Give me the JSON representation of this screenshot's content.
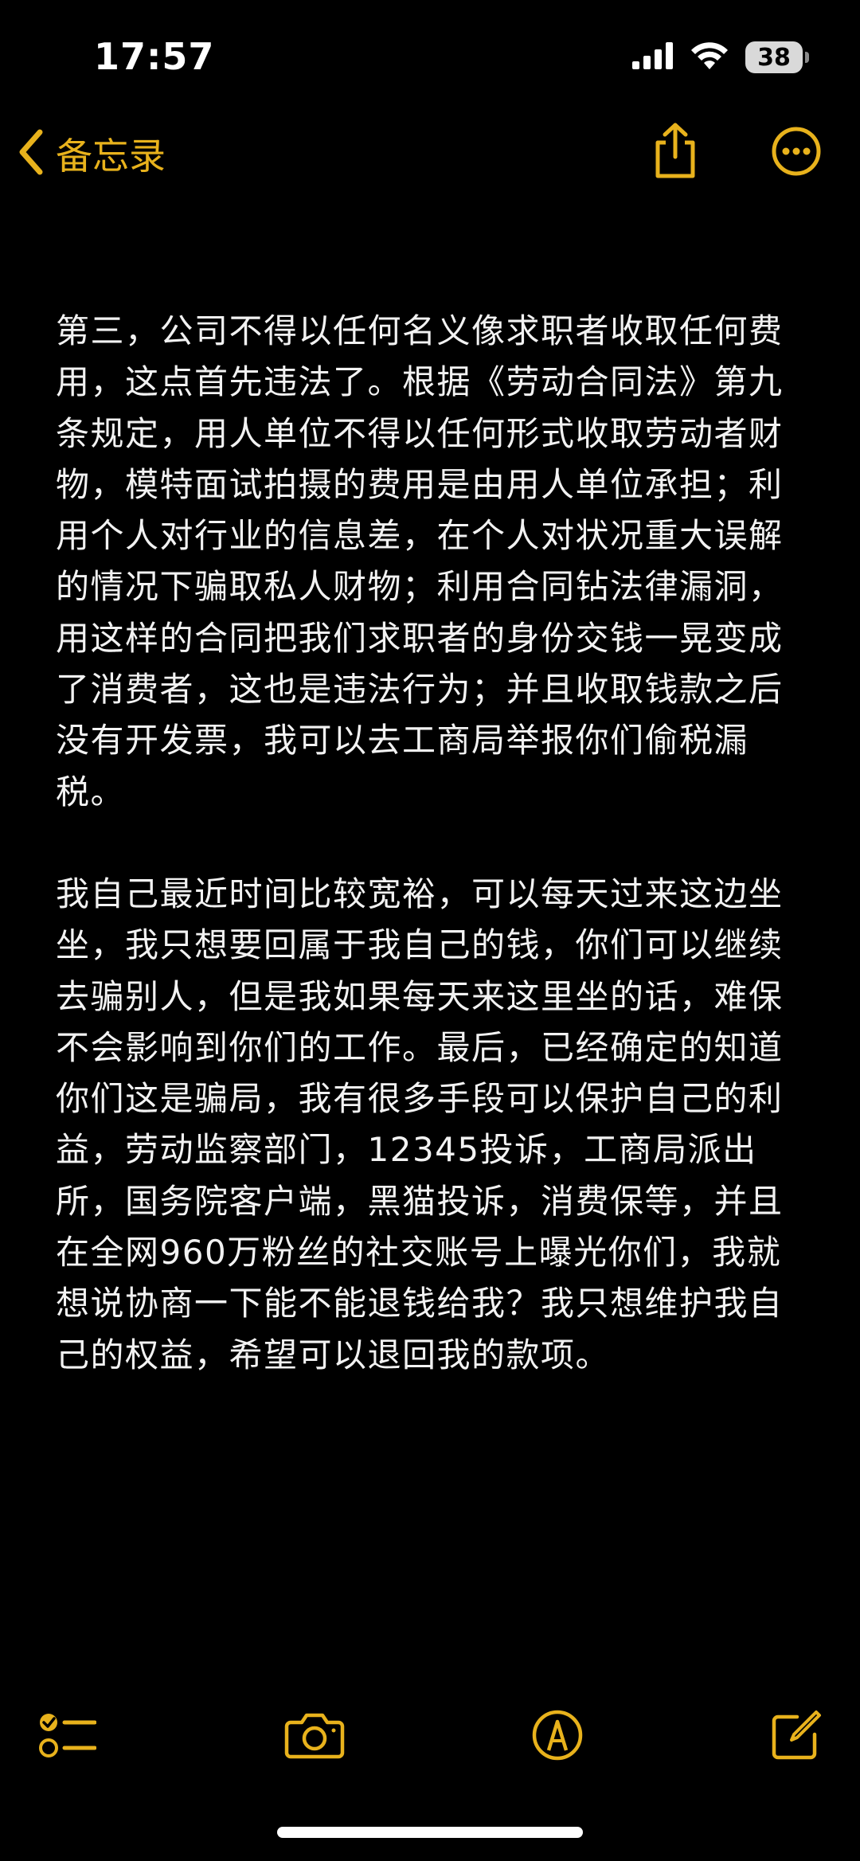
{
  "status_bar": {
    "time": "17:57",
    "battery": "38",
    "icons": [
      "cellular-signal-icon",
      "wifi-icon",
      "battery-icon"
    ]
  },
  "nav": {
    "back_label": "备忘录",
    "icons": [
      "chevron-left-icon",
      "share-icon",
      "more-icon"
    ],
    "accent_color": "#e8b21c"
  },
  "note": {
    "paragraphs": [
      "第三，公司不得以任何名义像求职者收取任何费用，这点首先违法了。根据《劳动合同法》第九条规定，用人单位不得以任何形式收取劳动者财物，模特面试拍摄的费用是由用人单位承担；利用个人对行业的信息差，在个人对状况重大误解的情况下骗取私人财物；利用合同钻法律漏洞，用这样的合同把我们求职者的身份交钱一晃变成了消费者，这也是违法行为；并且收取钱款之后没有开发票，我可以去工商局举报你们偷税漏税。",
      "我自己最近时间比较宽裕，可以每天过来这边坐坐，我只想要回属于我自己的钱，你们可以继续去骗别人，但是我如果每天来这里坐的话，难保不会影响到你们的工作。最后，已经确定的知道你们这是骗局，我有很多手段可以保护自己的利益，劳动监察部门，12345投诉，工商局派出所，国务院客户端，黑猫投诉，消费保等，并且在全网960万粉丝的社交账号上曝光你们，我就想说协商一下能不能退钱给我？我只想维护我自己的权益，希望可以退回我的款项。"
    ]
  },
  "toolbar": {
    "icons": [
      "checklist-icon",
      "camera-icon",
      "markup-pen-icon",
      "compose-icon"
    ]
  }
}
